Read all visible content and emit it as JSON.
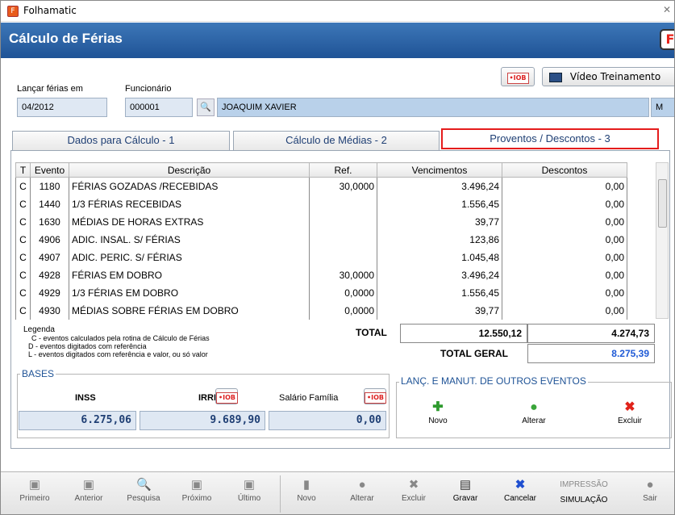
{
  "window": {
    "app_title": "Folhamatic",
    "close_glyph": "✕"
  },
  "header": {
    "title": "Cálculo de Férias",
    "logo_letter": "F"
  },
  "top_buttons": {
    "flag_label": "•IOB",
    "video_label": "Vídeo Treinamento"
  },
  "fields": {
    "lancar_label": "Lançar férias em",
    "lancar_value": "04/2012",
    "funcionario_label": "Funcionário",
    "funcionario_code": "000001",
    "funcionario_name": "JOAQUIM XAVIER",
    "extra_flag": "M"
  },
  "tabs": [
    {
      "label": "Dados para Cálculo - 1"
    },
    {
      "label": "Cálculo de Médias - 2"
    },
    {
      "label": "Proventos / Descontos - 3"
    }
  ],
  "table": {
    "headers": [
      "T",
      "Evento",
      "Descrição",
      "Ref.",
      "Vencimentos",
      "Descontos"
    ],
    "rows": [
      {
        "t": "C",
        "evento": "1180",
        "descricao": "FÉRIAS GOZADAS /RECEBIDAS",
        "ref": "30,0000",
        "venc": "3.496,24",
        "desc": "0,00"
      },
      {
        "t": "C",
        "evento": "1440",
        "descricao": "1/3 FÉRIAS RECEBIDAS",
        "ref": "",
        "venc": "1.556,45",
        "desc": "0,00"
      },
      {
        "t": "C",
        "evento": "1630",
        "descricao": "MÉDIAS DE HORAS EXTRAS",
        "ref": "",
        "venc": "39,77",
        "desc": "0,00"
      },
      {
        "t": "C",
        "evento": "4906",
        "descricao": "ADIC. INSAL. S/ FÉRIAS",
        "ref": "",
        "venc": "123,86",
        "desc": "0,00"
      },
      {
        "t": "C",
        "evento": "4907",
        "descricao": "ADIC. PERIC. S/ FÉRIAS",
        "ref": "",
        "venc": "1.045,48",
        "desc": "0,00"
      },
      {
        "t": "C",
        "evento": "4928",
        "descricao": "FÉRIAS EM DOBRO",
        "ref": "30,0000",
        "venc": "3.496,24",
        "desc": "0,00"
      },
      {
        "t": "C",
        "evento": "4929",
        "descricao": "1/3 FÉRIAS EM DOBRO",
        "ref": "0,0000",
        "venc": "1.556,45",
        "desc": "0,00"
      },
      {
        "t": "C",
        "evento": "4930",
        "descricao": "MÉDIAS SOBRE FÉRIAS EM DOBRO",
        "ref": "0,0000",
        "venc": "39,77",
        "desc": "0,00"
      }
    ]
  },
  "totals": {
    "total_label": "TOTAL",
    "total_venc": "12.550,12",
    "total_desc": "4.274,73",
    "geral_label": "TOTAL GERAL",
    "geral_value": "8.275,39"
  },
  "legend": {
    "title": "Legenda",
    "lines": [
      "C - eventos calculados pela rotina de Cálculo de Férias",
      "D - eventos digitados com referência",
      "L - eventos digitados com referência e valor, ou só valor"
    ]
  },
  "bases": {
    "title": "BASES",
    "inss_label": "INSS",
    "irrf_label": "IRRF",
    "salario_label": "Salário Família",
    "inss_value": "6.275,06",
    "irrf_value": "9.689,90",
    "salario_value": "0,00"
  },
  "lanc": {
    "title": "LANÇ. E MANUT. DE OUTROS EVENTOS",
    "novo": "Novo",
    "alterar": "Alterar",
    "excluir": "Excluir"
  },
  "bottom": {
    "primeiro": "Primeiro",
    "anterior": "Anterior",
    "pesquisa": "Pesquisa",
    "proximo": "Próximo",
    "ultimo": "Último",
    "novo": "Novo",
    "alterar": "Alterar",
    "excluir": "Excluir",
    "gravar": "Gravar",
    "cancelar": "Cancelar",
    "impressao": "IMPRESSÃO",
    "simulacao": "SIMULAÇÃO",
    "sair": "Sair"
  }
}
